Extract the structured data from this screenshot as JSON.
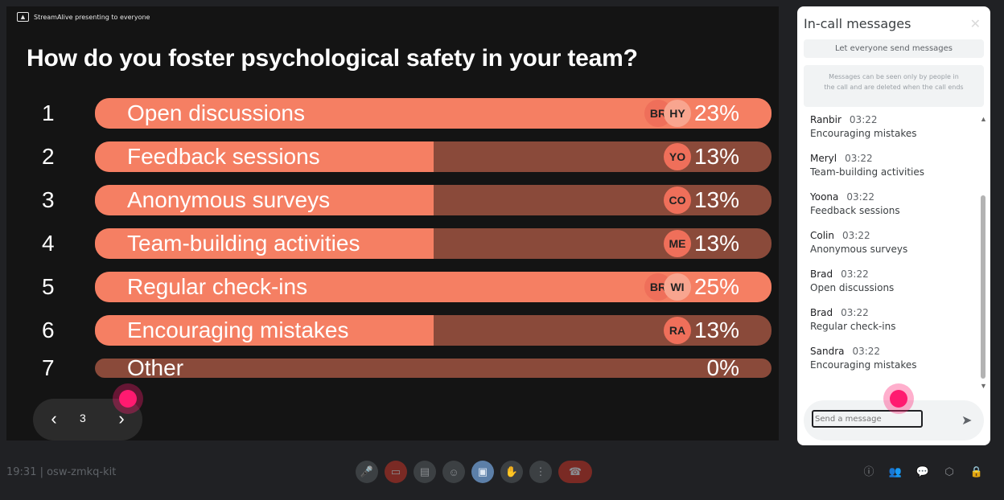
{
  "presenting_badge": "StreamAlive presenting to everyone",
  "question": "How do you foster psychological safety in your team?",
  "poll": [
    {
      "n": "1",
      "label": "Open discussions",
      "pct": "23%",
      "fill": 1.0,
      "avatars": [
        "BR",
        "HY"
      ]
    },
    {
      "n": "2",
      "label": "Feedback sessions",
      "pct": "13%",
      "fill": 0.501,
      "avatars": [
        "YO"
      ]
    },
    {
      "n": "3",
      "label": "Anonymous surveys",
      "pct": "13%",
      "fill": 0.501,
      "avatars": [
        "CO"
      ]
    },
    {
      "n": "4",
      "label": "Team-building activities",
      "pct": "13%",
      "fill": 0.501,
      "avatars": [
        "ME"
      ]
    },
    {
      "n": "5",
      "label": "Regular check-ins",
      "pct": "25%",
      "fill": 1.0,
      "avatars": [
        "BR",
        "WI"
      ]
    },
    {
      "n": "6",
      "label": "Encouraging mistakes",
      "pct": "13%",
      "fill": 0.501,
      "avatars": [
        "RA"
      ]
    },
    {
      "n": "7",
      "label": "Other",
      "pct": "0%",
      "fill": 0.0,
      "avatars": []
    }
  ],
  "pager": {
    "page": "3",
    "prev_icon": "chevron-left-icon",
    "next_icon": "chevron-right-icon"
  },
  "chat": {
    "title": "In-call messages",
    "toggle": "Let everyone send messages",
    "note": "Messages can be seen only by people in the call and are deleted when the call ends",
    "messages": [
      {
        "who": "Ranbir",
        "time": "03:22",
        "text": "Encouraging mistakes"
      },
      {
        "who": "Meryl",
        "time": "03:22",
        "text": "Team-building activities"
      },
      {
        "who": "Yoona",
        "time": "03:22",
        "text": "Feedback sessions"
      },
      {
        "who": "Colin",
        "time": "03:22",
        "text": "Anonymous surveys"
      },
      {
        "who": "Brad",
        "time": "03:22",
        "text": "Open discussions"
      },
      {
        "who": "Brad",
        "time": "03:22",
        "text": "Regular check-ins"
      },
      {
        "who": "Sandra",
        "time": "03:22",
        "text": "Encouraging mistakes"
      }
    ],
    "input_placeholder": "Send a message"
  },
  "bottom": {
    "meeting_info": "19:31 | osw-zmkq-kit"
  },
  "colors": {
    "bar_fill": "#f57f63",
    "bar_track": "#8a4a3a",
    "accent_dot": "#ff1a70"
  }
}
